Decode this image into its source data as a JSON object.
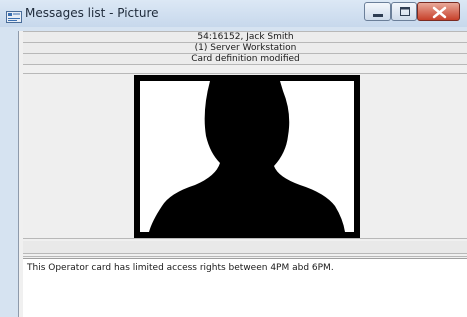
{
  "window": {
    "title": "Messages list - Picture",
    "icon": "messages-list-icon"
  },
  "controls": {
    "minimize_icon": "minimize-icon",
    "maximize_icon": "maximize-icon",
    "close_icon": "close-icon"
  },
  "header": {
    "card_user": "54:16152, Jack Smith",
    "workstation": "(1)  Server Workstation",
    "event": "Card definition modified"
  },
  "picture": {
    "kind": "person-silhouette"
  },
  "message": {
    "text": "This Operator card has limited access rights between 4PM abd 6PM."
  },
  "colors": {
    "title_bar": "#c7d8ec",
    "close_button": "#c7402a",
    "photo_frame": "#000000"
  }
}
